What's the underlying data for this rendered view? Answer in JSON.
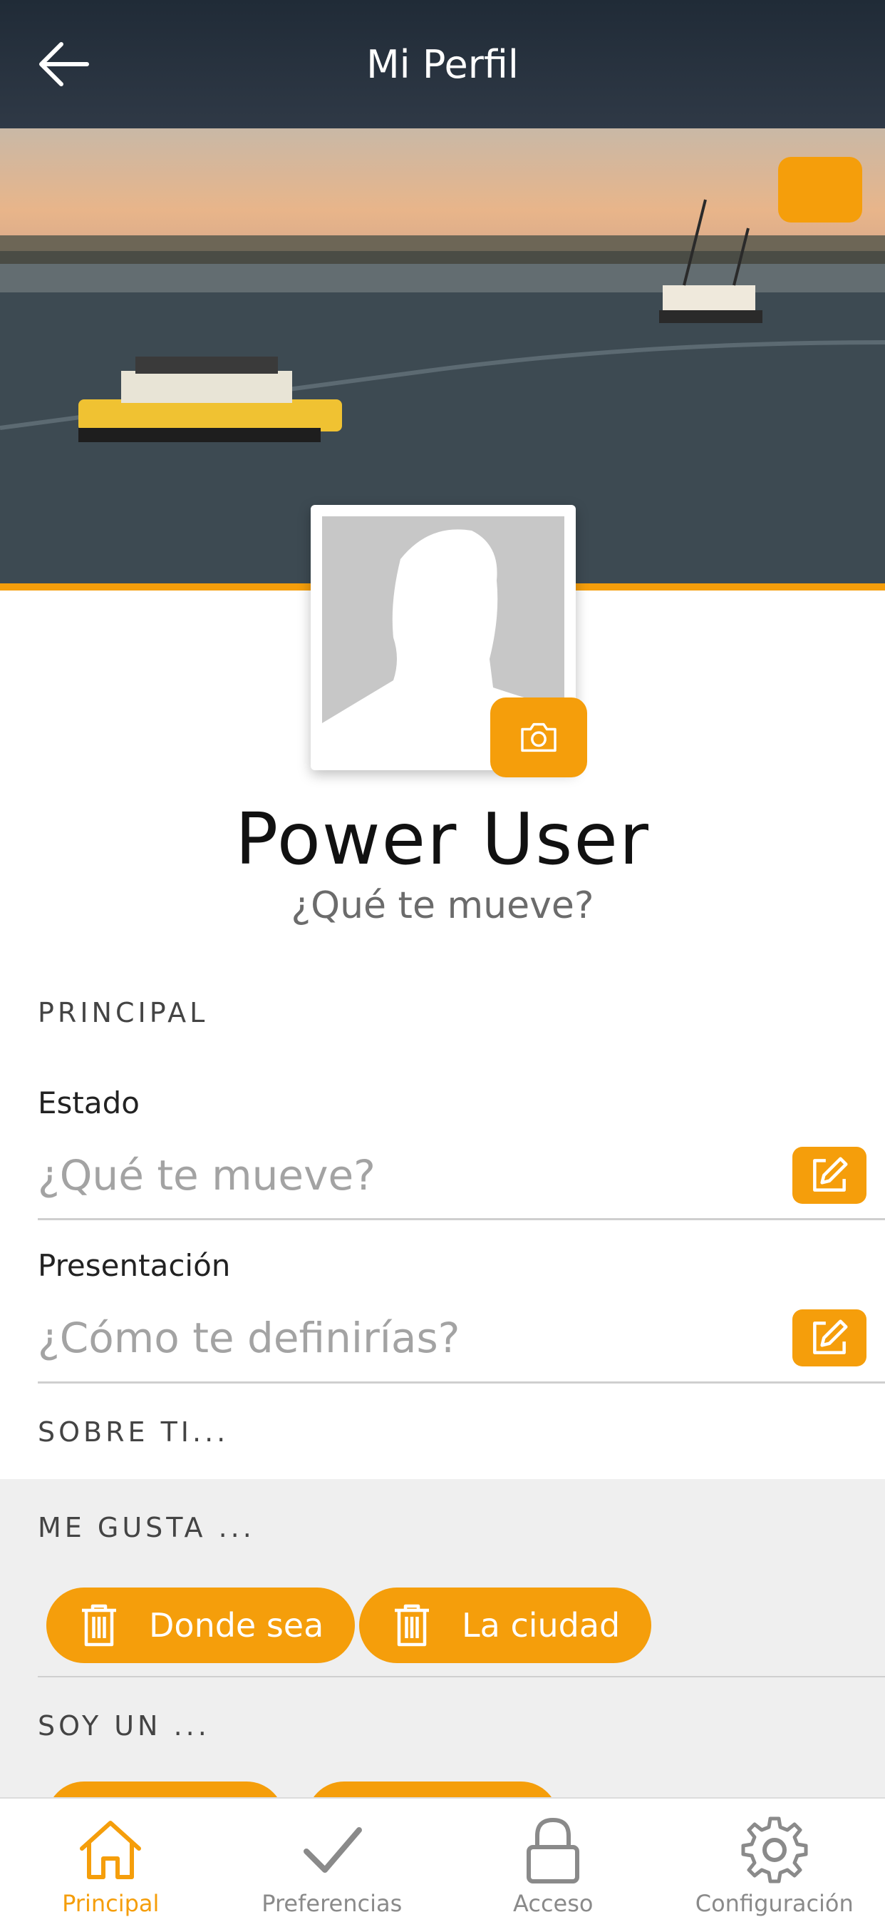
{
  "header": {
    "title": "Mi Perfil",
    "back_icon": "arrow-left-icon"
  },
  "cover": {
    "camera_icon": "camera-icon"
  },
  "profile": {
    "name": "Power User",
    "status": "¿Qué te mueve?",
    "avatar_icon": "person-silhouette-icon"
  },
  "sections": {
    "principal": "PRINCIPAL",
    "sobre_ti": "SOBRE TI...",
    "me_gusta": "ME GUSTA ...",
    "soy_un": "SOY UN ..."
  },
  "fields": [
    {
      "label": "Estado",
      "placeholder": "¿Qué te mueve?"
    },
    {
      "label": "Presentación",
      "placeholder": "¿Cómo te definirías?"
    }
  ],
  "likes": [
    "Donde sea",
    "La ciudad"
  ],
  "nav": [
    {
      "label": "Principal",
      "icon": "home-icon",
      "active": true
    },
    {
      "label": "Preferencias",
      "icon": "check-icon",
      "active": false
    },
    {
      "label": "Acceso",
      "icon": "lock-icon",
      "active": false
    },
    {
      "label": "Configuración",
      "icon": "gear-icon",
      "active": false
    }
  ],
  "colors": {
    "accent": "#f59e0b",
    "header": "#252f3b",
    "inactive": "#8a8a8a"
  }
}
